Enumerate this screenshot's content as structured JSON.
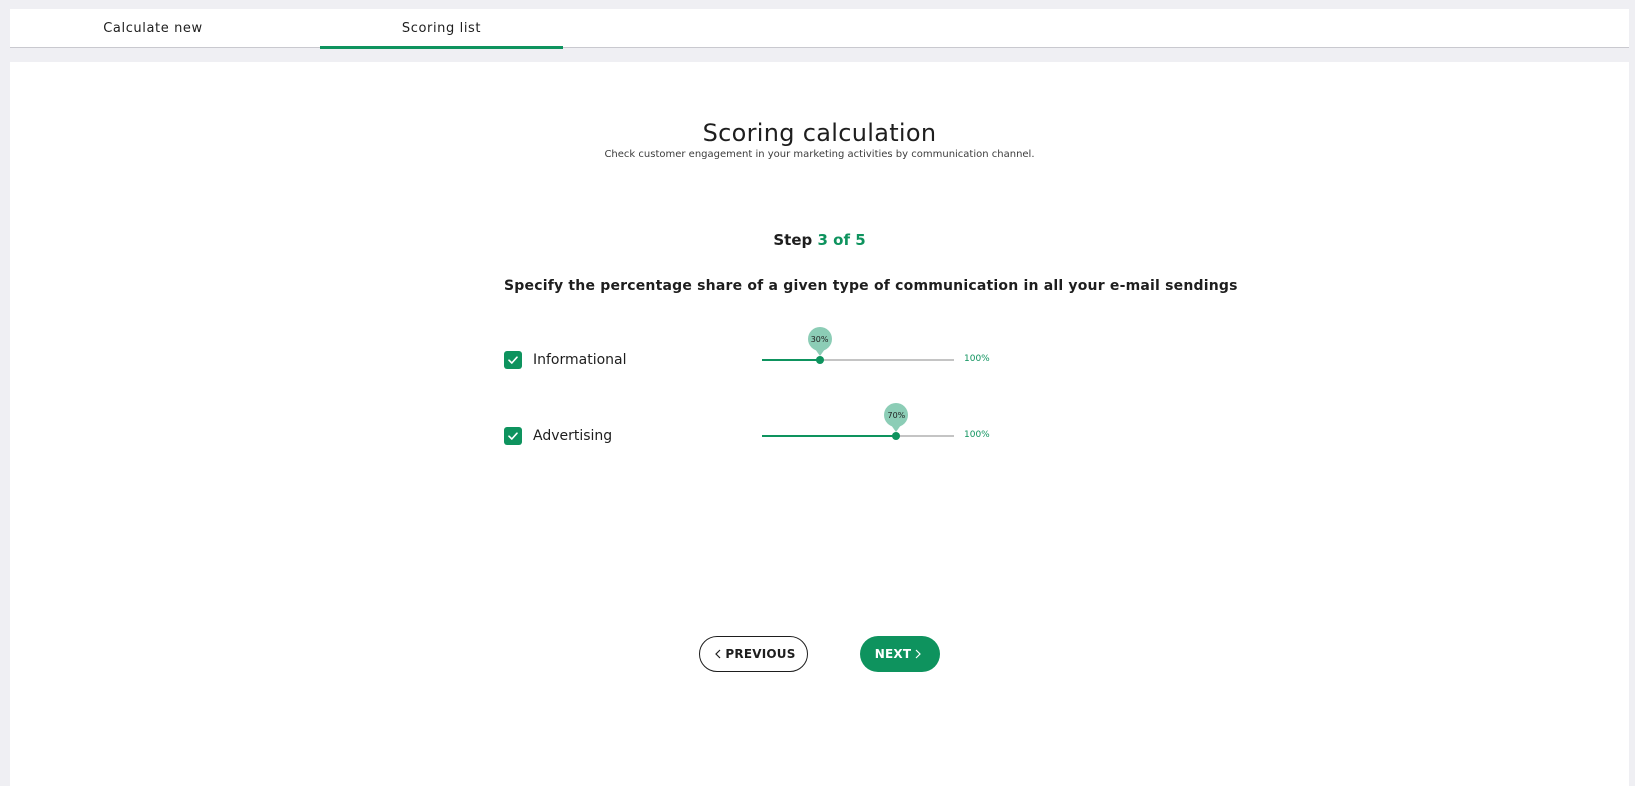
{
  "tabs": [
    {
      "label": "Calculate new",
      "active": false
    },
    {
      "label": "Scoring list",
      "active": true
    }
  ],
  "header": {
    "title": "Scoring calculation",
    "subtitle": "Check customer engagement in your marketing activities by communication channel."
  },
  "step": {
    "prefix": "Step",
    "progress": "3 of 5",
    "current": 3,
    "total": 5
  },
  "question": "Specify the percentage share of a given type of communication in all your e-mail sendings",
  "options": [
    {
      "label": "Informational",
      "checked": true,
      "value_percent": 30,
      "value_label": "30%",
      "max_label": "100%"
    },
    {
      "label": "Advertising",
      "checked": true,
      "value_percent": 70,
      "value_label": "70%",
      "max_label": "100%"
    }
  ],
  "buttons": {
    "previous": "PREVIOUS",
    "next": "NEXT"
  },
  "colors": {
    "accent": "#0e935e",
    "bubble": "#8ccdb6",
    "track": "#c4c4c4"
  },
  "icons": {
    "checkbox": "check-icon",
    "previous": "chevron-left-icon",
    "next": "chevron-right-icon"
  }
}
